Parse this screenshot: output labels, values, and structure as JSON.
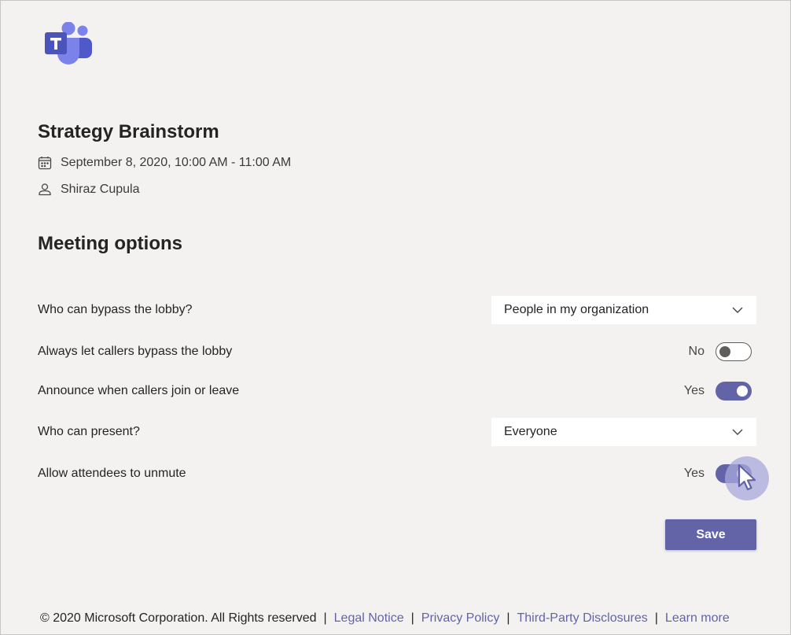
{
  "meeting": {
    "title": "Strategy Brainstorm",
    "datetime": "September 8, 2020, 10:00 AM - 11:00 AM",
    "organizer": "Shiraz Cupula"
  },
  "options_section": {
    "title": "Meeting options",
    "lobby_bypass": {
      "label": "Who can bypass the lobby?",
      "value": "People in my organization"
    },
    "callers_bypass": {
      "label": "Always let callers bypass the lobby",
      "state": "No",
      "on": false
    },
    "announce": {
      "label": "Announce when callers join or leave",
      "state": "Yes",
      "on": true
    },
    "presenters": {
      "label": "Who can present?",
      "value": "Everyone"
    },
    "unmute": {
      "label": "Allow attendees to unmute",
      "state": "Yes",
      "on": true
    }
  },
  "actions": {
    "save_label": "Save"
  },
  "footer": {
    "copyright": "© 2020 Microsoft Corporation. All Rights reserved",
    "separator": "|",
    "links": [
      "Legal Notice",
      "Privacy Policy",
      "Third-Party Disclosures",
      "Learn more"
    ]
  },
  "icons": {
    "logo": "microsoft-teams-logo",
    "date": "calendar-icon",
    "organizer": "person-icon",
    "dropdown": "chevron-down-icon",
    "pointer": "mouse-cursor-icon"
  },
  "colors": {
    "accent": "#6264a7",
    "background": "#f3f2f1",
    "link": "#6264a7",
    "cursor_halo": "#a8a8dc"
  }
}
